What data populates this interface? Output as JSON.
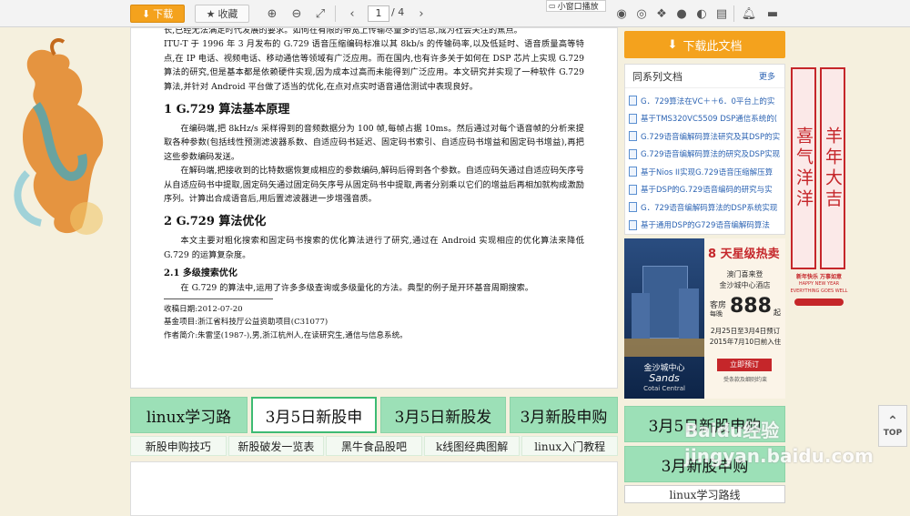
{
  "toolbar": {
    "download_label": "下载",
    "favorite_label": "收藏",
    "page_current": "1",
    "page_total": "/ 4",
    "mini_window_label": "小窗口播放"
  },
  "document": {
    "intro_lines": "ITU-T 于 1996 年 3 月发布的 G.729 语音压缩编码标准以其 8kb/s 的传输码率,以及低延时、语音质量高等特点,在 IP 电话、视频电话、移动通信等领域有广泛应用。而在国内,也有许多关于如何在 DSP 芯片上实现 G.729 算法的研究,但是基本都是依赖硬件实现,因为成本过高而未能得到广泛应用。本文研究并实现了一种软件 G.729 算法,并针对 Android 平台做了适当的优化,在点对点实时语音通信测试中表现良好。",
    "first_line": "长,已经无法满足时代发展的要求。如何在有限的带宽上传输尽量多的信息,成为社会关注的焦点。",
    "sec1_title": "1 G.729 算法基本原理",
    "sec1_p1": "在编码端,把 8kHz/s 采样得到的音频数据分为 100 帧,每帧占据 10ms。然后通过对每个语音帧的分析来提取各种参数(包括线性预测滤波器系数、自适应码书延迟、固定码书索引、自适应码书增益和固定码书增益),再把这些参数编码发送。",
    "sec1_p2": "在解码端,把接收到的比特数据恢复成相应的参数编码,解码后得到各个参数。自适应码矢通过自适应码矢序号从自适应码书中提取,固定码矢通过固定码矢序号从固定码书中提取,两者分别乘以它们的增益后再相加就构成激励序列。计算出合成语音后,用后置滤波器进一步增强音质。",
    "sec2_title": "2 G.729 算法优化",
    "sec2_p1": "本文主要对粗化搜索和固定码书搜索的优化算法进行了研究,通过在 Android 实现相应的优化算法来降低 G.729 的运算复杂度。",
    "sec21_title": "2.1 多级搜索优化",
    "sec21_p1": "在 G.729 的算法中,运用了许多多级查询或多级量化的方法。典型的例子是开环基音周期搜索。",
    "meta_received": "收稿日期:2012-07-20",
    "meta_fund": "基金项目:浙江省科技厅公益资助项目(C31077)",
    "meta_author": "作者简介:朱雷坚(1987-),男,浙江杭州人,在读研究生,通信与信息系统。"
  },
  "ads": {
    "row1": [
      "linux学习路",
      "3月5日新股申",
      "3月5日新股发",
      "3月新股申购"
    ],
    "row2": [
      "新股申购技巧",
      "新股破发一览表",
      "黑牛食品股吧",
      "k线图经典图解",
      "linux入门教程"
    ]
  },
  "right": {
    "download_doc_label": "下载此文档",
    "series_title": "同系列文档",
    "series_more": "更多",
    "series_items": [
      "G．729算法在VC＋＋6．0平台上的实",
      "基于TMS320VC5509 DSP通信系统的(",
      "G.729语音编解码算法研究及其DSP的实",
      "G.729语音编解码算法的研究及DSP实现",
      "基于Nios II实现G.729语音压缩解压算",
      "基于DSP的G.729语音编码的研究与实",
      "G．729语音编解码算法的DSP系统实现",
      "基于通用DSP的G729语音编解码算法"
    ],
    "hotel_ad": {
      "headline": "8 天星级热卖",
      "sub1": "澳门喜来登",
      "sub2": "金沙城中心酒店",
      "price_label": "客房",
      "price_sub": "每晚",
      "price": "888",
      "price_suffix": "起",
      "date1": "2月25日至3月4日预订",
      "date2": "2015年7月10日前入住",
      "cta": "立即预订",
      "cta_note": "受条款及细则约束",
      "brand": "金沙城中心",
      "brand_en": "Sands",
      "brand_en2": "Cotai Central"
    },
    "right_ads": [
      "3月5日新股申购",
      "3月新股申购",
      "linux学习路线"
    ],
    "couplet_left": "喜气洋洋",
    "couplet_right": "羊年大吉",
    "couplet_caption1": "新年快乐 万事如意",
    "couplet_caption2": "HAPPY NEW YEAR",
    "couplet_caption3": "EVERYTHING GOES WELL"
  },
  "top_button_label": "TOP",
  "watermark": "Baidu经验 jingyan.baidu.com",
  "colors": {
    "accent_orange": "#f4a21d",
    "ad_green": "#9ce0b7",
    "link_blue": "#2d64b3",
    "red": "#c5262a"
  }
}
